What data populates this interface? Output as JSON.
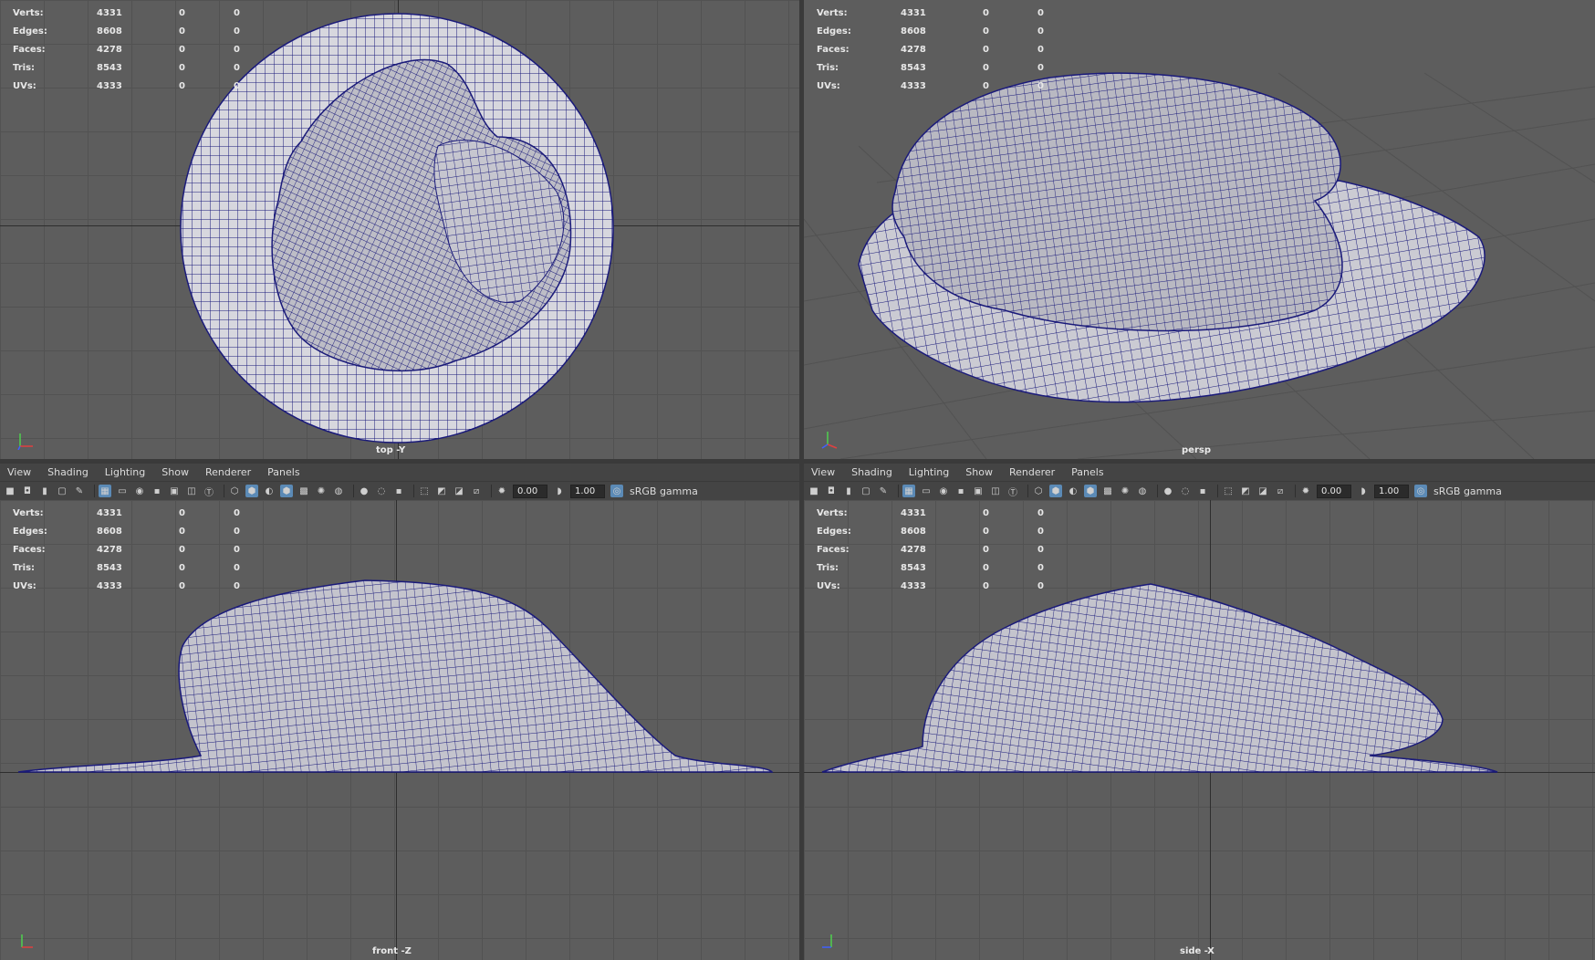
{
  "hud_labels": {
    "verts": "Verts:",
    "edges": "Edges:",
    "faces": "Faces:",
    "tris": "Tris:",
    "uvs": "UVs:"
  },
  "hud_values": {
    "verts": [
      "4331",
      "0",
      "0"
    ],
    "edges": [
      "8608",
      "0",
      "0"
    ],
    "faces": [
      "4278",
      "0",
      "0"
    ],
    "tris": [
      "8543",
      "0",
      "0"
    ],
    "uvs": [
      "4333",
      "0",
      "0"
    ]
  },
  "panes": {
    "top": {
      "camera": "top -Y"
    },
    "persp": {
      "camera": "persp"
    },
    "front": {
      "camera": "front -Z"
    },
    "side": {
      "camera": "side -X"
    }
  },
  "menu": {
    "view": "View",
    "shading": "Shading",
    "lighting": "Lighting",
    "show": "Show",
    "renderer": "Renderer",
    "panels": "Panels"
  },
  "toolbar": {
    "exposure": "0.00",
    "gamma": "1.00",
    "color_space": "sRGB gamma"
  },
  "colors": {
    "viewport_bg": "#5d5d5d",
    "wire": "#1a1a7a",
    "mesh_fill": "#c9c9d2",
    "selected_icon": "#5b8ab6"
  },
  "icons": [
    "camera-icon",
    "grid-icon",
    "wireframe-icon",
    "smooth-shade-icon",
    "lights-icon",
    "shadows-icon",
    "isolate-icon",
    "exposure-icon",
    "gamma-icon",
    "color-space-icon"
  ]
}
